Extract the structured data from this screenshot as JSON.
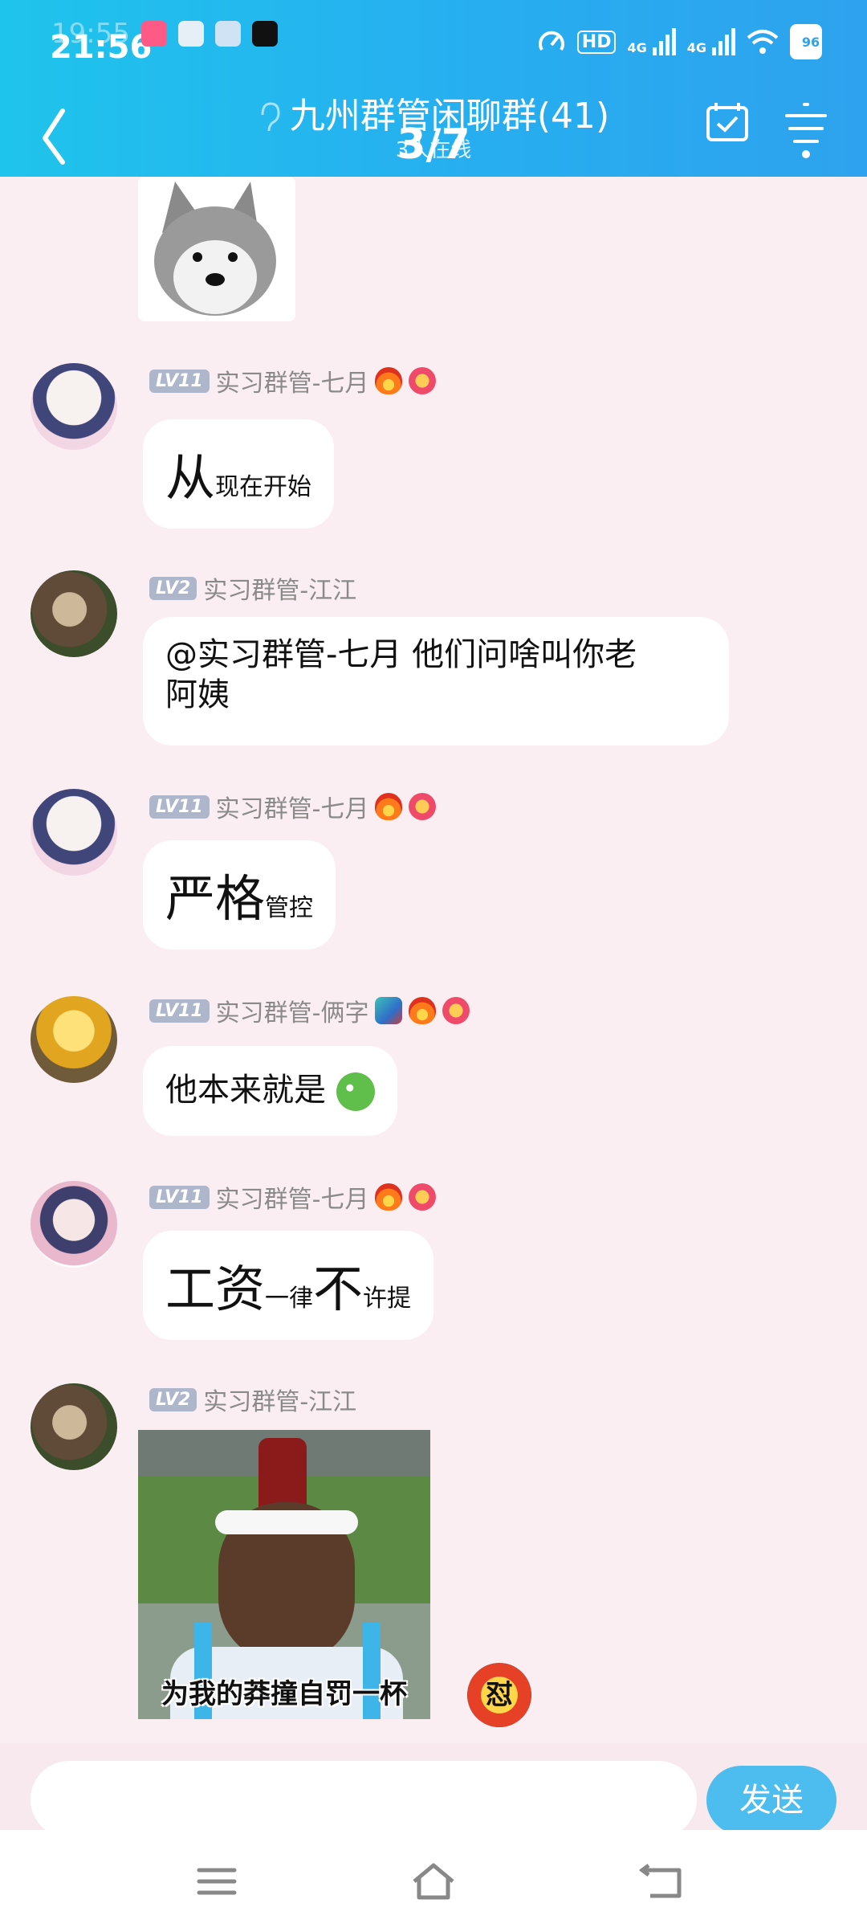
{
  "status_bar": {
    "time": "21:56",
    "time_ghost": "19:55",
    "network": [
      "HD",
      "4G",
      "4G"
    ],
    "battery": "96"
  },
  "header": {
    "title": "九州群管闲聊群(41)",
    "subtitle": "3人在线",
    "page_indicator": "3/7"
  },
  "messages": [
    {
      "sender": "实习群管-七月",
      "level": "LV11",
      "parts": [
        {
          "text": "从",
          "size": "big"
        },
        {
          "text": "现在开始",
          "size": "small"
        }
      ]
    },
    {
      "sender": "实习群管-江江",
      "level": "LV2",
      "text_lines": [
        "@实习群管-七月 他们问啥叫你老",
        "阿姨"
      ]
    },
    {
      "sender": "实习群管-七月",
      "level": "LV11",
      "parts": [
        {
          "text": "严格",
          "size": "big"
        },
        {
          "text": "管控",
          "size": "small"
        }
      ]
    },
    {
      "sender": "实习群管-俩字",
      "level": "LV11",
      "text": "他本来就是"
    },
    {
      "sender": "实习群管-七月",
      "level": "LV11",
      "parts": [
        {
          "text": "工资",
          "size": "big"
        },
        {
          "text": "一律",
          "size": "small"
        },
        {
          "text": "不",
          "size": "big"
        },
        {
          "text": "许提",
          "size": "small"
        }
      ]
    },
    {
      "sender": "实习群管-江江",
      "level": "LV2",
      "image_caption": "为我的莽撞自罚一杯",
      "reaction": "怼"
    }
  ],
  "input": {
    "placeholder": "",
    "send_label": "发送"
  },
  "colors": {
    "header_start": "#1fc4ec",
    "header_end": "#2ea2ee",
    "chat_bg": "#fbeef2",
    "send": "#4dbdf0"
  }
}
